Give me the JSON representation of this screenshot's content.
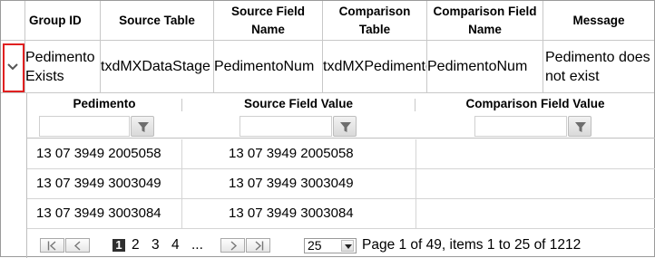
{
  "outer_grid": {
    "columns": [
      "Group ID",
      "Source Table",
      "Source Field Name",
      "Comparison Table",
      "Comparison Field Name",
      "Message"
    ],
    "row": {
      "group_id": "Pedimento Exists",
      "source_table": "txdMXDataStage",
      "source_field": "PedimentoNum",
      "comparison_table": "txdMXPedimento",
      "comparison_field": "PedimentoNum",
      "message": "Pedimento does not exist"
    },
    "expand_icon": "chevron-down-icon",
    "highlight_color": "#e02020"
  },
  "detail_grid": {
    "columns": [
      "Pedimento",
      "Source Field Value",
      "Comparison Field Value"
    ],
    "filter_icon": "funnel-icon",
    "rows": [
      {
        "pedimento": "13 07 3949 2005058",
        "source_value": "13 07 3949 2005058",
        "comparison_value": ""
      },
      {
        "pedimento": "13 07 3949 3003049",
        "source_value": "13 07 3949 3003049",
        "comparison_value": ""
      },
      {
        "pedimento": "13 07 3949 3003084",
        "source_value": "13 07 3949 3003084",
        "comparison_value": ""
      }
    ]
  },
  "pager": {
    "pages": [
      "1",
      "2",
      "3",
      "4",
      "..."
    ],
    "current_page": "1",
    "page_size": "25",
    "info": "Page 1 of 49, items 1 to 25 of 1212"
  }
}
